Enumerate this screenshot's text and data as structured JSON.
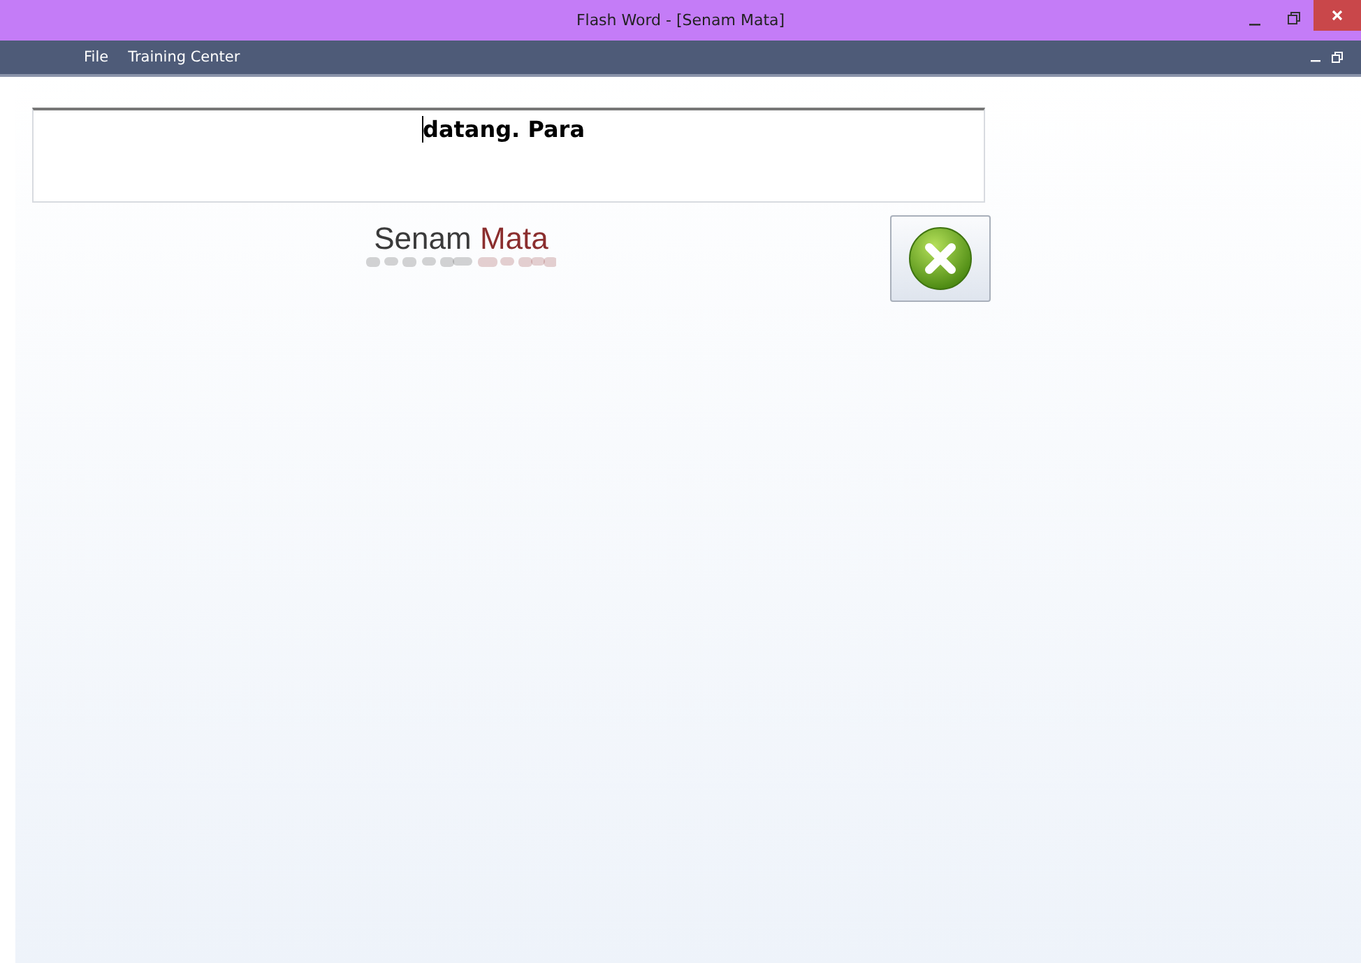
{
  "window": {
    "title": "Flash Word - [Senam Mata]"
  },
  "menu": [
    "File",
    "Training Center"
  ],
  "word_box": {
    "value": "datang. Para",
    "caret": true
  },
  "heading": {
    "first": "Senam",
    "second": "Mata",
    "reflected": true
  },
  "close_exercise_button": {
    "disabled": false
  }
}
